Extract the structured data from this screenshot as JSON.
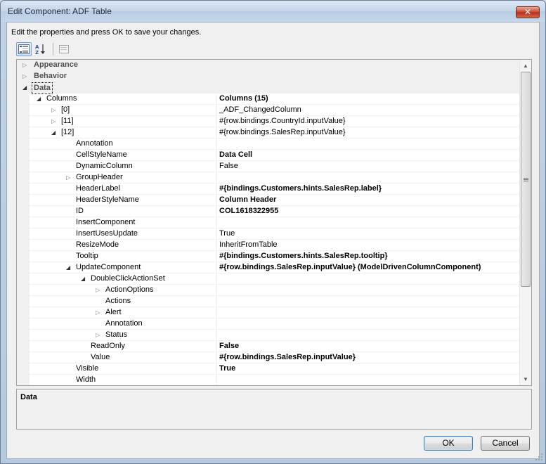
{
  "window": {
    "title": "Edit Component: ADF Table",
    "close_glyph": "✕"
  },
  "instructions": "Edit the properties and press OK to save your changes.",
  "toolbar": {
    "categorized_icon": "categorized-view-icon",
    "alphabetical_icon": "alphabetical-sort-icon",
    "property_pages_icon": "property-pages-icon"
  },
  "grid": {
    "rows": [
      {
        "kind": "category",
        "name": "Appearance",
        "expander": "collapsed"
      },
      {
        "kind": "category",
        "name": "Behavior",
        "expander": "collapsed"
      },
      {
        "kind": "category",
        "name": "Data",
        "expander": "expanded",
        "selected": true
      },
      {
        "name": "Columns",
        "value": "Columns (15)",
        "bold": true,
        "expander": "expanded",
        "indent": 0
      },
      {
        "name": "[0]",
        "value": "_ADF_ChangedColumn",
        "expander": "collapsed",
        "indent": 1
      },
      {
        "name": "[11]",
        "value": "#{row.bindings.CountryId.inputValue}",
        "expander": "collapsed",
        "indent": 1
      },
      {
        "name": "[12]",
        "value": "#{row.bindings.SalesRep.inputValue}",
        "expander": "expanded",
        "indent": 1
      },
      {
        "name": "Annotation",
        "value": "",
        "indent": 2
      },
      {
        "name": "CellStyleName",
        "value": "Data Cell",
        "bold": true,
        "indent": 2
      },
      {
        "name": "DynamicColumn",
        "value": "False",
        "indent": 2
      },
      {
        "name": "GroupHeader",
        "value": "",
        "expander": "collapsed",
        "indent": 2
      },
      {
        "name": "HeaderLabel",
        "value": "#{bindings.Customers.hints.SalesRep.label}",
        "bold": true,
        "indent": 2
      },
      {
        "name": "HeaderStyleName",
        "value": "Column Header",
        "bold": true,
        "indent": 2
      },
      {
        "name": "ID",
        "value": "COL1618322955",
        "bold": true,
        "indent": 2
      },
      {
        "name": "InsertComponent",
        "value": "",
        "indent": 2
      },
      {
        "name": "InsertUsesUpdate",
        "value": "True",
        "indent": 2
      },
      {
        "name": "ResizeMode",
        "value": "InheritFromTable",
        "indent": 2
      },
      {
        "name": "Tooltip",
        "value": "#{bindings.Customers.hints.SalesRep.tooltip}",
        "bold": true,
        "indent": 2
      },
      {
        "name": "UpdateComponent",
        "value": "#{row.bindings.SalesRep.inputValue} (ModelDrivenColumnComponent)",
        "bold": true,
        "expander": "expanded",
        "indent": 2
      },
      {
        "name": "DoubleClickActionSet",
        "value": "",
        "expander": "expanded",
        "indent": 3
      },
      {
        "name": "ActionOptions",
        "value": "",
        "expander": "collapsed",
        "indent": 4
      },
      {
        "name": "Actions",
        "value": "",
        "indent": 4
      },
      {
        "name": "Alert",
        "value": "",
        "expander": "collapsed",
        "indent": 4
      },
      {
        "name": "Annotation",
        "value": "",
        "indent": 4
      },
      {
        "name": "Status",
        "value": "",
        "expander": "collapsed",
        "indent": 4
      },
      {
        "name": "ReadOnly",
        "value": "False",
        "bold": true,
        "indent": 3
      },
      {
        "name": "Value",
        "value": "#{row.bindings.SalesRep.inputValue}",
        "bold": true,
        "indent": 3
      },
      {
        "name": "Visible",
        "value": "True",
        "bold": true,
        "indent": 2
      },
      {
        "name": "Width",
        "value": "",
        "indent": 2
      }
    ]
  },
  "description": {
    "title": "Data"
  },
  "buttons": {
    "ok": "OK",
    "cancel": "Cancel"
  }
}
